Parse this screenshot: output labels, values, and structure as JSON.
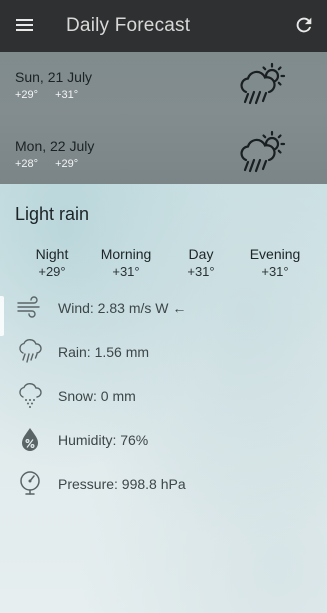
{
  "toolbar": {
    "title": "Daily Forecast",
    "menu_icon": "hamburger-menu-icon",
    "refresh_icon": "refresh-icon"
  },
  "forecast_days": [
    {
      "date": "Sun, 21 July",
      "temp_low": "+29°",
      "temp_high": "+31°",
      "icon": "rain-cloud-sun-icon"
    },
    {
      "date": "Mon, 22 July",
      "temp_low": "+28°",
      "temp_high": "+29°",
      "icon": "rain-cloud-sun-icon"
    }
  ],
  "detail": {
    "condition": "Light rain",
    "periods": [
      {
        "label": "Night",
        "temp": "+29°"
      },
      {
        "label": "Morning",
        "temp": "+31°"
      },
      {
        "label": "Day",
        "temp": "+31°"
      },
      {
        "label": "Evening",
        "temp": "+31°"
      }
    ],
    "wind": "Wind: 2.83 m/s W ←",
    "rain": "Rain: 1.56 mm",
    "snow": "Snow: 0 mm",
    "humidity": "Humidity: 76%",
    "pressure": "Pressure: 998.8 hPa"
  },
  "colors": {
    "toolbar_bg": "#2f3031",
    "list_bg": "#818b8e",
    "detail_bg": "#dfeaec"
  }
}
